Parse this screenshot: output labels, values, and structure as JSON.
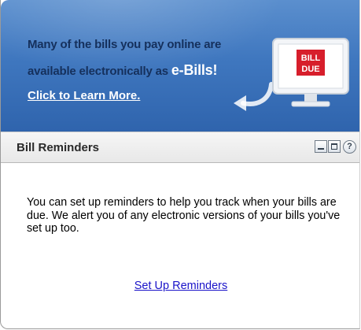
{
  "banner": {
    "line1": "Many of the bills you pay online are",
    "line2_prefix": "available electronically as ",
    "line2_highlight": "e-Bills!",
    "link": "Click to Learn More.",
    "monitor_icon": "bill-due-monitor-icon",
    "monitor_text_1": "BILL",
    "monitor_text_2": "DUE"
  },
  "widget": {
    "title": "Bill Reminders",
    "help_symbol": "?",
    "description": "You can set up reminders to help you track when your bills are due. We alert you of any electronic versions of your bills you've set up too.",
    "action_link": "Set Up Reminders"
  },
  "colors": {
    "banner_blue": "#3f77bf",
    "link_blue": "#1a13c9",
    "monitor_red": "#d71e2b"
  }
}
